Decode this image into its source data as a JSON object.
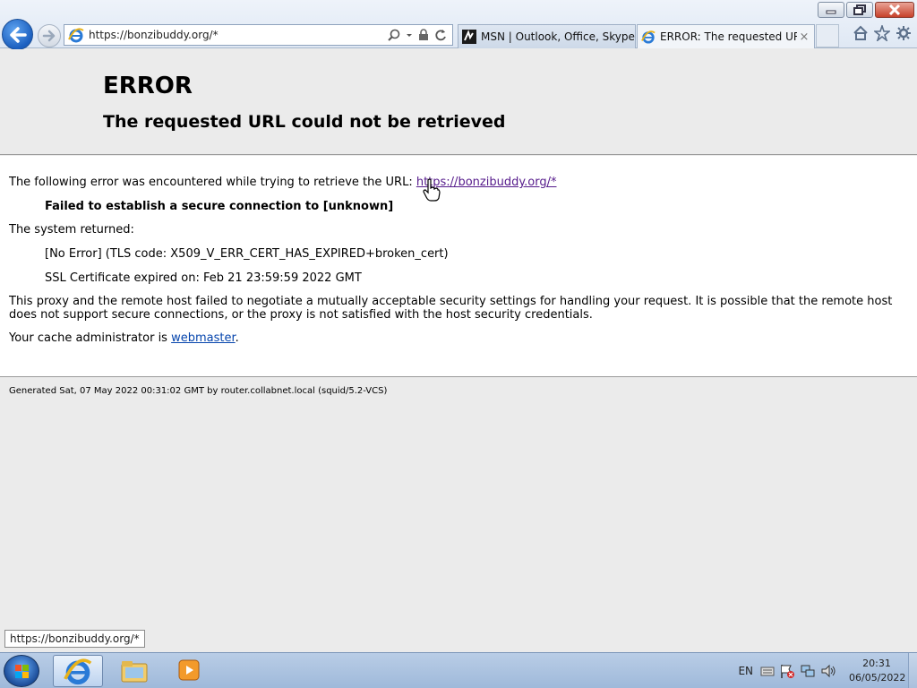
{
  "browser": {
    "address_url": "https://bonzibuddy.org/*",
    "tabs": [
      {
        "label": "MSN | Outlook, Office, Skype, ...",
        "icon": "msn-icon"
      },
      {
        "label": "ERROR: The requested URL ...",
        "icon": "ie-icon",
        "close": "×"
      }
    ]
  },
  "page": {
    "header": {
      "title": "ERROR",
      "subtitle": "The requested URL could not be retrieved"
    },
    "body": {
      "intro": "The following error was encountered while trying to retrieve the URL:",
      "url_link": "https://bonzibuddy.org/*",
      "failure": "Failed to establish a secure connection to [unknown]",
      "system_returned": "The system returned:",
      "tls_error": "[No Error] (TLS code: X509_V_ERR_CERT_HAS_EXPIRED+broken_cert)",
      "ssl_expired": "SSL Certificate expired on: Feb 21 23:59:59 2022 GMT",
      "explanation": "This proxy and the remote host failed to negotiate a mutually acceptable security settings for handling your request. It is possible that the remote host does not support secure connections, or the proxy is not satisfied with the host security credentials.",
      "admin_prefix": "Your cache administrator is",
      "admin_link": "webmaster",
      "admin_suffix": "."
    },
    "footer": "Generated Sat, 07 May 2022 00:31:02 GMT by router.collabnet.local (squid/5.2-VCS)"
  },
  "status_tooltip": "https://bonzibuddy.org/*",
  "taskbar": {
    "language": "EN",
    "time": "20:31",
    "date": "06/05/2022"
  },
  "colors": {
    "visited_link": "#551a8b",
    "link": "#0645ad",
    "ie_blue": "#1b5fbf"
  }
}
